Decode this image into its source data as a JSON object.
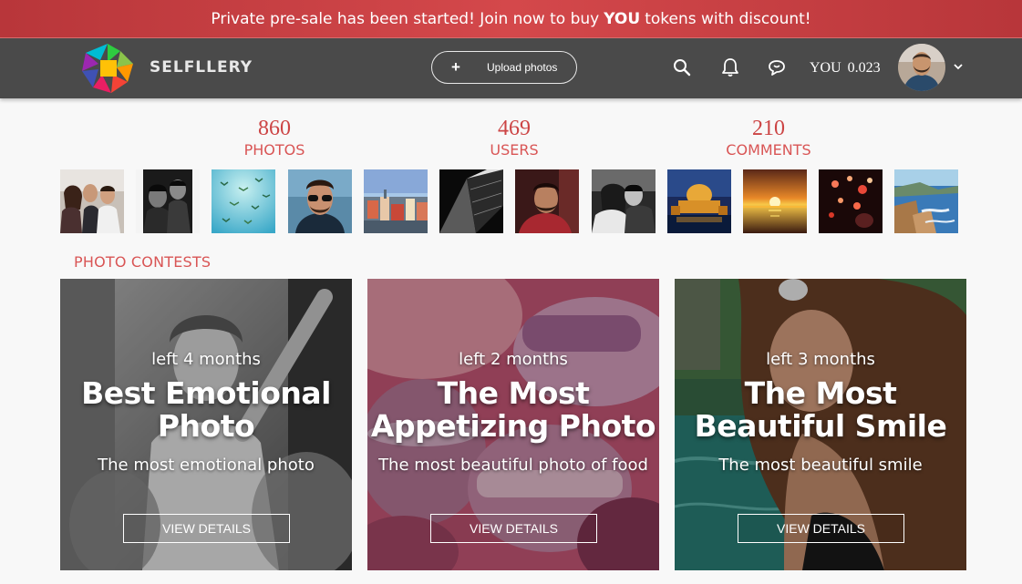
{
  "promo": {
    "text_before": "Private pre-sale has been started! Join now to buy",
    "token_bold": "YOU",
    "text_after": "tokens with discount!"
  },
  "header": {
    "brand": "SELFLLERY",
    "upload_label": "Upload photos",
    "upload_plus": "+",
    "token_symbol": "YOU",
    "token_balance": "0.023",
    "icons": [
      "search-icon",
      "bell-icon",
      "chat-icon",
      "chevron-down-icon"
    ]
  },
  "stats": [
    {
      "value": "860",
      "label": "PHOTOS"
    },
    {
      "value": "469",
      "label": "USERS"
    },
    {
      "value": "210",
      "label": "COMMENTS"
    }
  ],
  "section_title": "PHOTO CONTESTS",
  "contests": [
    {
      "left": "left 4 months",
      "title": "Best Emotional Photo",
      "subtitle": "The most emotional photo",
      "button": "VIEW DETAILS"
    },
    {
      "left": "left 2 months",
      "title": "The Most Appetizing Photo",
      "subtitle": "The most beautiful photo of food",
      "button": "VIEW DETAILS"
    },
    {
      "left": "left 3 months",
      "title": "The Most Beautiful Smile",
      "subtitle": "The most beautiful smile",
      "button": "VIEW DETAILS"
    }
  ]
}
